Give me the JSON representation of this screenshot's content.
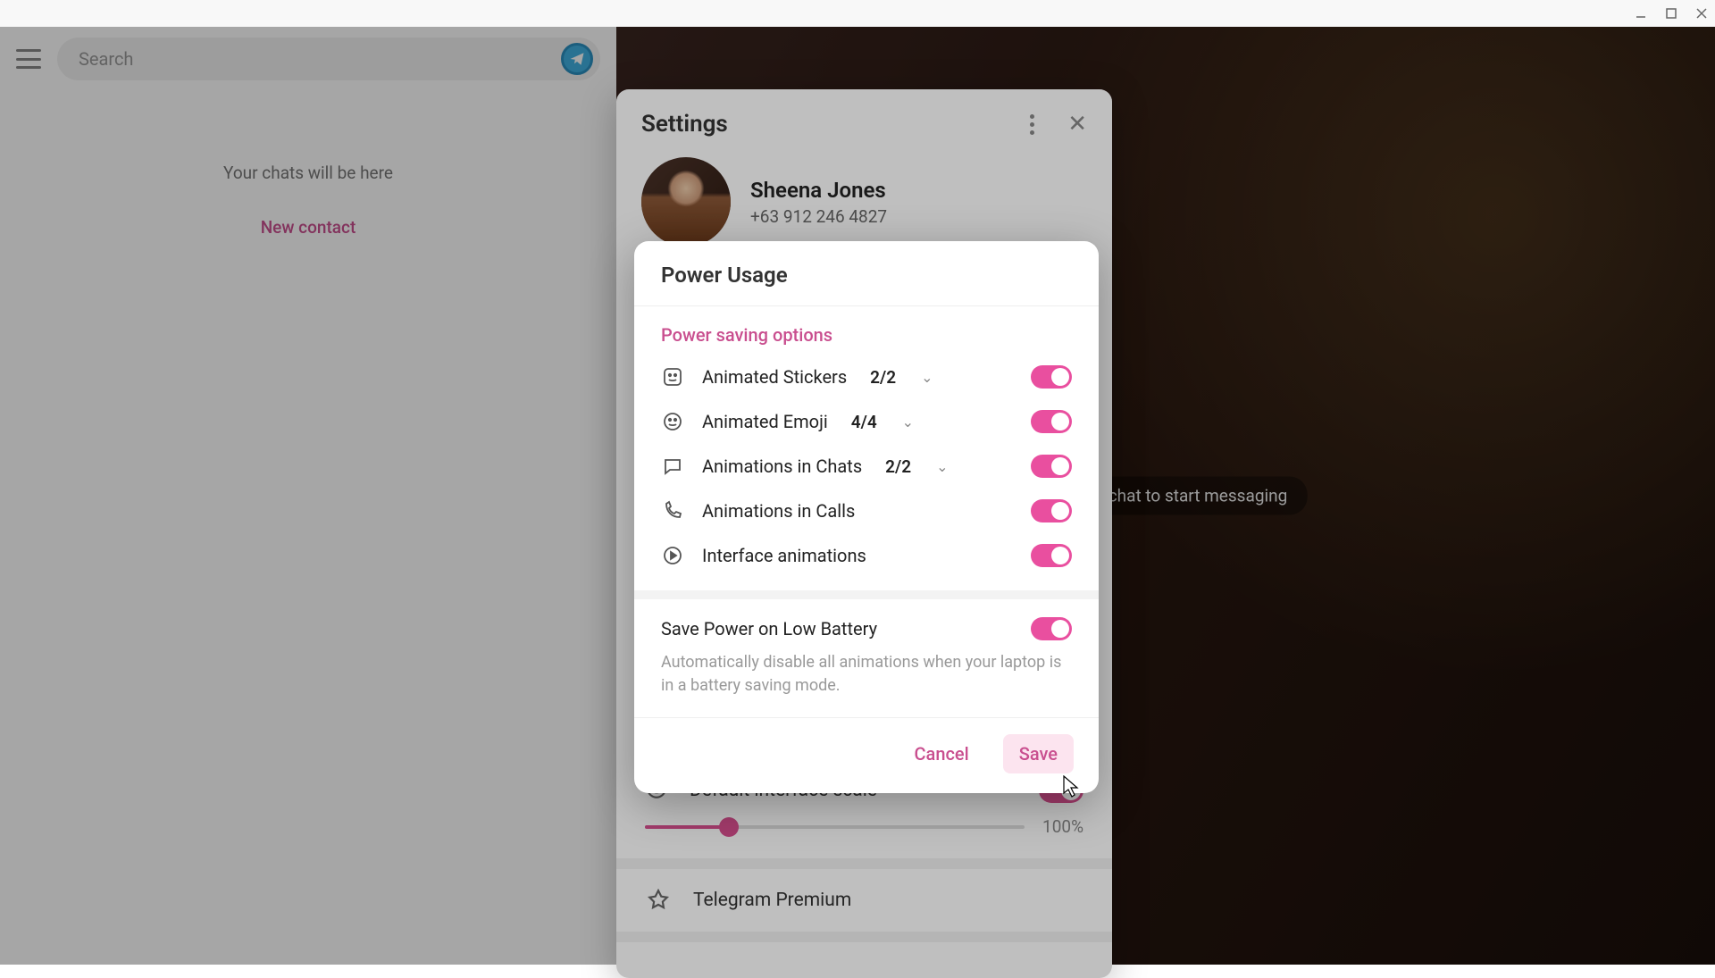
{
  "titlebar": {},
  "left": {
    "search_placeholder": "Search",
    "empty_text": "Your chats will be here",
    "new_contact": "New contact"
  },
  "right": {
    "hint": "Select a chat to start messaging"
  },
  "settings": {
    "title": "Settings",
    "profile_name": "Sheena Jones",
    "profile_phone": "+63 912 246 4827",
    "scale_label": "Default interface scale",
    "scale_value": "100%",
    "premium_label": "Telegram Premium"
  },
  "dialog": {
    "title": "Power Usage",
    "section": "Power saving options",
    "options": [
      {
        "label": "Animated Stickers",
        "count": "2/2",
        "has_chevron": true,
        "icon": "sticker"
      },
      {
        "label": "Animated Emoji",
        "count": "4/4",
        "has_chevron": true,
        "icon": "emoji"
      },
      {
        "label": "Animations in Chats",
        "count": "2/2",
        "has_chevron": true,
        "icon": "chat"
      },
      {
        "label": "Animations in Calls",
        "count": "",
        "has_chevron": false,
        "icon": "call"
      },
      {
        "label": "Interface animations",
        "count": "",
        "has_chevron": false,
        "icon": "play"
      }
    ],
    "battery_label": "Save Power on Low Battery",
    "battery_desc": "Automatically disable all animations when your laptop is in a battery saving mode.",
    "cancel": "Cancel",
    "save": "Save"
  }
}
